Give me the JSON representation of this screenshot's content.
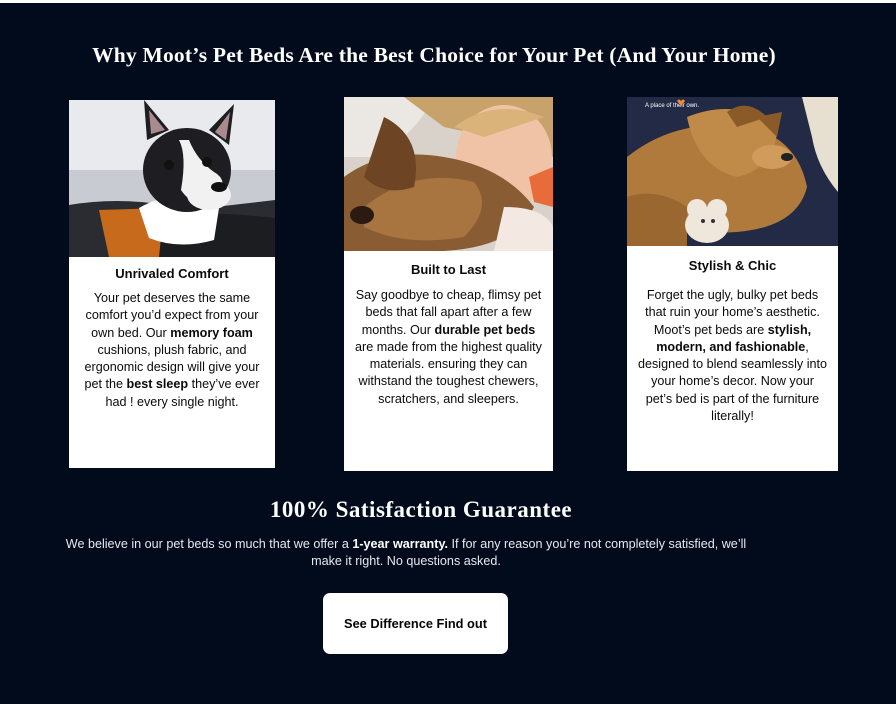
{
  "headline": "Why Moot’s Pet Beds Are the Best Choice for Your Pet (And Your Home)",
  "cards": [
    {
      "title": "Unrivaled Comfort",
      "text_parts": [
        "Your pet deserves the same comfort you’d expect from your own bed. Our ",
        "memory foam",
        " cushions, plush fabric, and ergonomic design will give your pet the ",
        "best sleep",
        " they’ve ever had ! every single night."
      ],
      "image": "boston-terrier-on-sofa"
    },
    {
      "title": "Built to Last",
      "text_parts": [
        "Say goodbye to cheap, flimsy pet beds that fall apart after a few months. Our ",
        "durable pet beds",
        " are made from the highest quality materials. ensuring they can withstand the toughest chewers, scratchers, and sleepers."
      ],
      "image": "child-hugging-dog"
    },
    {
      "title": "Stylish & Chic",
      "text_parts": [
        "Forget the ugly, bulky pet beds that ruin your home’s aesthetic. Moot’s pet beds are ",
        "stylish, modern, and fashionable",
        ", designed to blend seamlessly into your home’s decor. Now your pet’s bed is part of the furniture literally!"
      ],
      "image": "puppy-sleeping-with-toy",
      "image_caption": "A place of their own."
    }
  ],
  "guarantee": {
    "title": "100% Satisfaction Guarantee",
    "text_before": "We believe in our pet beds so much that we offer a ",
    "text_bold": "1-year warranty.",
    "text_after": " If for any reason you’re not completely satisfied, we’ll make it right. No questions asked."
  },
  "cta_label": "See Difference Find out",
  "colors": {
    "background": "#020b1c",
    "card": "#ffffff",
    "button": "#ffffff",
    "heart": "#f08a3c"
  }
}
